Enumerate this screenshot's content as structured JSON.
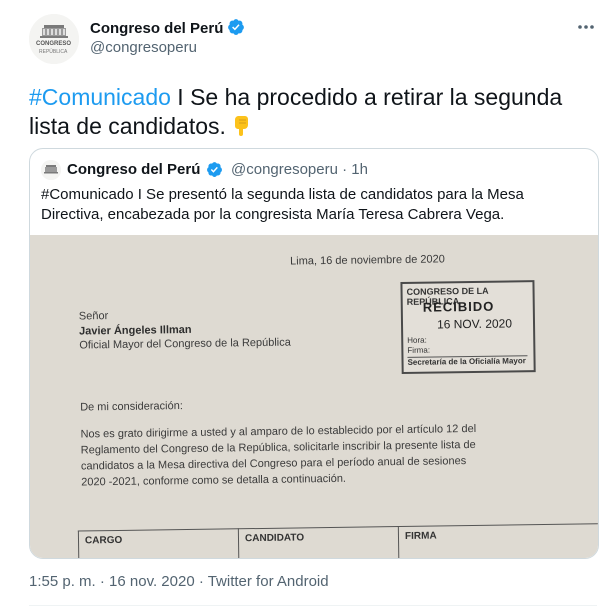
{
  "author": {
    "name": "Congreso del Perú",
    "handle": "@congresoperu",
    "avatar_text": [
      "CONGRESO",
      "REPÚBLICA"
    ]
  },
  "tweet": {
    "hashtag": "#Comunicado",
    "text": " I Se ha procedido a retirar la segunda lista de candidatos."
  },
  "quoted": {
    "name": "Congreso del Perú",
    "handle": "@congresoperu",
    "time": "· 1h",
    "text": "#Comunicado I Se presentó la segunda lista de candidatos para la Mesa Directiva, encabezada por la congresista María Teresa Cabrera Vega."
  },
  "document": {
    "date": "Lima, 16 de noviembre de 2020",
    "salutation": "Señor",
    "recipient": "Javier Ángeles Illman",
    "recipient_title": "Oficial Mayor del Congreso de la República",
    "greeting": "De mi consideración:",
    "body_lines": [
      "Nos es grato dirigirme a usted y al amparo de lo establecido por el artículo 12 del",
      "Reglamento del Congreso de la República, solicitarle inscribir la presente lista de",
      "candidatos a la Mesa directiva del Congreso para el período anual de sesiones",
      "2020 -2021, conforme como se detalla a continuación."
    ],
    "stamp": {
      "line1": "CONGRESO DE LA REPÚBLICA",
      "line2": "RECIBIDO",
      "line3": "16 NOV. 2020",
      "hora": "Hora:",
      "firma": "Firma:",
      "office": "Secretaría de la Oficialía Mayor"
    },
    "table_headers": [
      "CARGO",
      "CANDIDATO",
      "FIRMA"
    ]
  },
  "footer": {
    "timestamp": "1:55 p. m. · 16 nov. 2020 · Twitter for Android"
  },
  "colors": {
    "link": "#1d9bf0",
    "verified": "#1d9bf0",
    "secondary_text": "#536471"
  },
  "icons": [
    "verified-badge-icon",
    "more-options-icon",
    "pointing-down-emoji-icon"
  ]
}
